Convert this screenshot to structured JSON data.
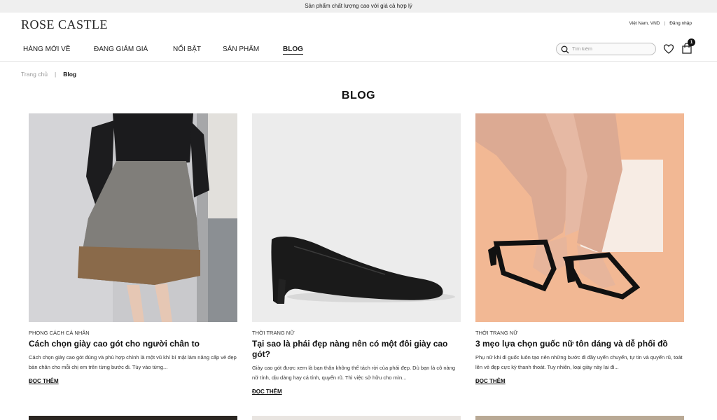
{
  "announcement": "Sản phẩm chất lượng cao với giá cả hợp lý",
  "header": {
    "logo": "ROSE CASTLE",
    "locale": "Việt Nam, VND",
    "separator": "|",
    "login": "Đăng nhập",
    "nav": [
      "HÀNG MỚI VỀ",
      "ĐANG GIẢM GIÁ",
      "NỔI BẬT",
      "SẢN PHẨM",
      "BLOG"
    ],
    "search_placeholder": "Tìm kiếm",
    "cart_count": "1"
  },
  "breadcrumb": {
    "home": "Trang chủ",
    "separator": "|",
    "current": "Blog"
  },
  "page_title": "BLOG",
  "posts": [
    {
      "category": "PHONG CÁCH CÁ NHÂN",
      "title": "Cách chọn giày cao gót cho người chân to",
      "excerpt": "Cách chọn giày cao gót đúng và phù hợp chính là một vũ khí bí mật làm nâng cấp vẻ đẹp bàn chân cho mỗi chị em trên từng bước đi. Tùy vào từng...",
      "more": "ĐỌC THÊM"
    },
    {
      "category": "THỜI TRANG NỮ",
      "title": "Tại sao là phái đẹp nàng nên có một đôi giày cao gót?",
      "excerpt": "Giày cao gót được xem là bạn thân không thể tách rời của phái đẹp. Dù bạn là cô nàng nữ tính, dịu dàng hay cá tính, quyến rũ. Thì việc sở hữu cho mìn...",
      "more": "ĐỌC THÊM"
    },
    {
      "category": "THỜI TRANG NỮ",
      "title": "3 mẹo lựa chọn guốc nữ tôn dáng và dễ phối đồ",
      "excerpt": "Phụ nữ khi đi guốc luôn tạo nên những bước đi đầy uyển chuyển, tự tin và quyến rũ, toát lên vẻ đẹp cực kỳ thanh thoát. Tuy nhiên, loại giày này lại đi...",
      "more": "ĐỌC THÊM"
    }
  ],
  "colors": {
    "accent": "#111111",
    "topbar": "#efefef",
    "photo3_bg": "#f2b894",
    "photo2_bg": "#ececec"
  }
}
